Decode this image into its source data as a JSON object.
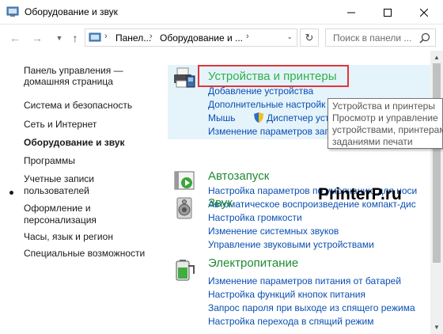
{
  "window": {
    "title": "Оборудование и звук",
    "minimize_icon": "minimize-icon",
    "maximize_icon": "maximize-icon",
    "close_icon": "close-icon"
  },
  "navigation": {
    "breadcrumbs": [
      "Панел...",
      "Оборудование и ..."
    ],
    "search_placeholder": "Поиск в панели ..."
  },
  "sidebar": {
    "home_line1": "Панель управления —",
    "home_line2": "домашняя страница",
    "items": [
      {
        "label": "Система и безопасность",
        "active": false
      },
      {
        "label": "Сеть и Интернет",
        "active": false
      },
      {
        "label": "Оборудование и звук",
        "active": true
      },
      {
        "label": "Программы",
        "active": false
      },
      {
        "label": "Учетные записи",
        "label2": "пользователей",
        "active": false
      },
      {
        "label": "Оформление и",
        "label2": "персонализация",
        "active": false
      },
      {
        "label": "Часы, язык и регион",
        "active": false
      },
      {
        "label": "Специальные возможности",
        "active": false
      }
    ]
  },
  "categories": [
    {
      "title": "Устройства и принтеры",
      "icon": "printer-icon",
      "links": [
        "Добавление устройства",
        "Дополнительные настройк",
        "Мышь",
        "Диспетчер уст",
        "Изменение параметров запу"
      ]
    },
    {
      "title": "Автозапуск",
      "icon": "autoplay-icon",
      "links": [
        "Настройка параметров по умолчанию для носи",
        "Автоматическое воспроизведение компакт-дис"
      ]
    },
    {
      "title": "Звук",
      "icon": "speaker-icon",
      "links": [
        "Настройка громкости",
        "Изменение системных звуков",
        "Управление звуковыми устройствами"
      ]
    },
    {
      "title": "Электропитание",
      "icon": "battery-icon",
      "links": [
        "Изменение параметров питания от батарей",
        "Настройка функций кнопок питания",
        "Запрос пароля при выходе из спящего режима",
        "Настройка перехода в спящий режим"
      ]
    }
  ],
  "tooltip": {
    "lines": [
      "Устройства и принтеры",
      "Просмотр и управление",
      "устройствами, принтерам",
      "заданиями печати"
    ]
  },
  "watermark": "PrinterP.ru",
  "colors": {
    "category_title": "#1e8a33",
    "link": "#0a4fb3",
    "highlight_bg": "#e5f3fb",
    "red_outline": "#e0363b"
  }
}
